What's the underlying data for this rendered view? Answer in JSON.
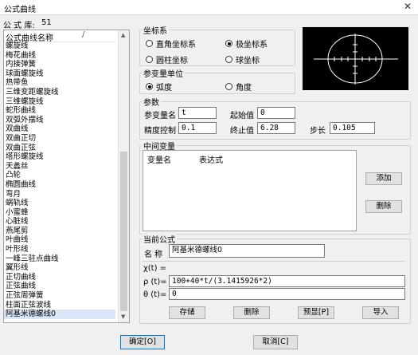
{
  "window": {
    "title": "公式曲线",
    "close_glyph": "✕"
  },
  "library": {
    "count_label": "公 式 库:",
    "count": "51",
    "column_header": "公式曲线名称",
    "sort_glyph": "/",
    "items": [
      "螺旋线",
      "梅花曲线",
      "内接弹簧",
      "球面螺旋线",
      "热带鱼",
      "三维变距螺旋线",
      "三维螺旋线",
      "蛇形曲线",
      "双弧外摆线",
      "双曲线",
      "双曲正切",
      "双曲正弦",
      "塔形螺旋线",
      "天蠡丝",
      "凸轮",
      "椭圆曲线",
      "弯月",
      "蜗轨线",
      "小蜜蜂",
      "心脏线",
      "燕尾剪",
      "叶曲线",
      "叶形线",
      "一峰三驻点曲线",
      "翼形线",
      "正切曲线",
      "正弦曲线",
      "正弦周弹簧",
      "柱面正弦波线",
      "阿基米德螺线0"
    ],
    "selected": "阿基米德螺线0"
  },
  "coord_system": {
    "title": "坐标系",
    "options": [
      {
        "label": "直角坐标系",
        "checked": false
      },
      {
        "label": "极坐标系",
        "checked": true
      },
      {
        "label": "圆柱坐标",
        "checked": false
      },
      {
        "label": "球坐标",
        "checked": false
      }
    ]
  },
  "param_unit": {
    "title": "参变量单位",
    "options": [
      {
        "label": "弧度",
        "checked": true
      },
      {
        "label": "角度",
        "checked": false
      }
    ]
  },
  "params": {
    "title": "参数",
    "var_name_label": "参变量名",
    "var_name_value": "t",
    "start_label": "起始值",
    "start_value": "0",
    "precision_label": "精度控制",
    "precision_value": "0.1",
    "end_label": "终止值",
    "end_value": "6.28",
    "step_label": "步长",
    "step_value": "0.105"
  },
  "intermediate": {
    "title": "中间变量",
    "col_var": "变量名",
    "col_expr": "表达式",
    "add_label": "添加",
    "delete_label": "删除"
  },
  "current_formula": {
    "title": "当前公式",
    "name_label": "名 称",
    "name_value": "阿基米德螺线0",
    "x_label": "χ(t) =",
    "rho_label": "ρ (t)=",
    "rho_value": "100+40*t/(3.1415926*2)",
    "theta_label": "θ (t)=",
    "theta_value": "0",
    "store_label": "存储",
    "delete_label": "删除",
    "preview_label": "预显[P]",
    "import_label": "导入"
  },
  "footer": {
    "ok_label": "确定[O]",
    "cancel_label": "取消[C]"
  },
  "colors": {
    "preview_bg": "#000000",
    "preview_curve": "#ffffff",
    "selection": "#d8e6f6"
  }
}
